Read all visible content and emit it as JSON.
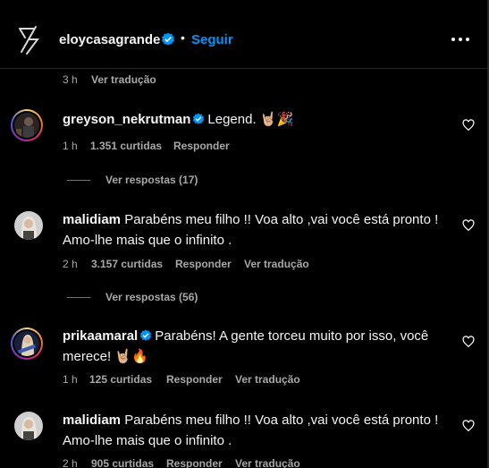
{
  "header": {
    "username": "eloycasagrande",
    "separator": "•",
    "follow_label": "Seguir"
  },
  "top_meta": {
    "time": "3 h",
    "translate": "Ver tradução"
  },
  "comments": [
    {
      "user": "greyson_nekrutman",
      "text": "Legend. 🤘🏼🎉",
      "time": "1 h",
      "likes": "1.351 curtidas",
      "reply": "Responder",
      "view_replies": "Ver respostas (17)"
    },
    {
      "user": "malidiam",
      "text": "Parabéns meu filho !! Voa alto ,vai você está pronto ! Amo-lhe mais que o infinito .",
      "time": "2 h",
      "likes": "3.157 curtidas",
      "reply": "Responder",
      "translate": "Ver tradução",
      "view_replies": "Ver respostas (56)"
    },
    {
      "user": "prikaamaral",
      "text": "Parabéns! A gente torceu muito por isso, você merece! 🤘🏼🔥",
      "time": "1 h",
      "likes": "125 curtidas",
      "reply": "Responder",
      "translate": "Ver tradução"
    },
    {
      "user": "malidiam",
      "text": "Parabéns meu filho !! Voa alto ,vai você está pronto ! Amo-lhe mais que o infinito .",
      "time": "2 h",
      "likes": "905 curtidas",
      "reply": "Responder",
      "translate": "Ver tradução"
    }
  ],
  "colors": {
    "accent": "#0095f6",
    "secondary_text": "#a8a8a8",
    "background": "#000000"
  }
}
